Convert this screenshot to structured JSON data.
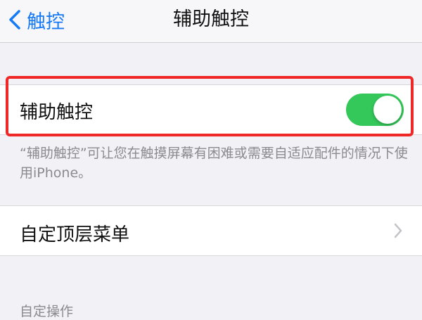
{
  "nav": {
    "back_label": "触控",
    "title": "辅助触控"
  },
  "assistive_touch": {
    "label": "辅助触控",
    "toggle_on": true,
    "toggle_color": "#34c759",
    "highlight_color": "#ef2727",
    "footnote": "“辅助触控”可让您在触摸屏幕有困难或需要自适应配件的情况下使用iPhone。"
  },
  "customize_menu": {
    "label": "自定顶层菜单"
  },
  "custom_actions": {
    "header": "自定操作"
  },
  "icons": {
    "back": "chevron-left-icon",
    "disclosure": "chevron-right-icon"
  },
  "colors": {
    "accent": "#1679f5",
    "background": "#f2f2f6"
  }
}
